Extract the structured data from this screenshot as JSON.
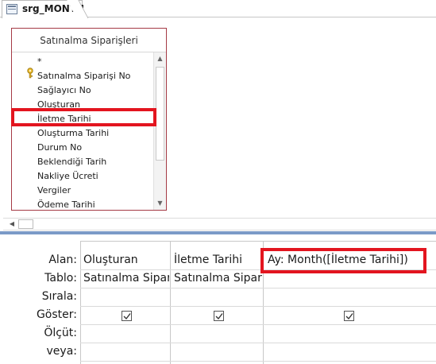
{
  "tab": {
    "title": "srg_MONTH",
    "icon": "query-icon"
  },
  "table_box": {
    "title": "Satınalma Siparişleri",
    "fields": [
      "*",
      "Satınalma Siparişi No",
      "Sağlayıcı No",
      "Oluşturan",
      "İletme Tarihi",
      "Oluşturma Tarihi",
      "Durum No",
      "Beklendiği Tarih",
      "Nakliye Ücreti",
      "Vergiler",
      "Ödeme Tarihi"
    ],
    "primary_key_field": "Satınalma Siparişi No",
    "highlighted_field": "İletme Tarihi"
  },
  "grid": {
    "row_labels": [
      "Alan:",
      "Tablo:",
      "Sırala:",
      "Göster:",
      "Ölçüt:",
      "veya:"
    ],
    "columns": [
      {
        "field": "Oluşturan",
        "table": "Satınalma Sipar",
        "sort": "",
        "show": true,
        "criteria": "",
        "or": ""
      },
      {
        "field": "İletme Tarihi",
        "table": "Satınalma Sipar",
        "sort": "",
        "show": true,
        "criteria": "",
        "or": ""
      },
      {
        "field": "Ay: Month([İletme Tarihi])",
        "table": "",
        "sort": "",
        "show": true,
        "criteria": "",
        "or": ""
      }
    ]
  },
  "colors": {
    "highlight": "#e3151f",
    "table_border": "#a53a45",
    "splitter": "#7b9ac7"
  }
}
